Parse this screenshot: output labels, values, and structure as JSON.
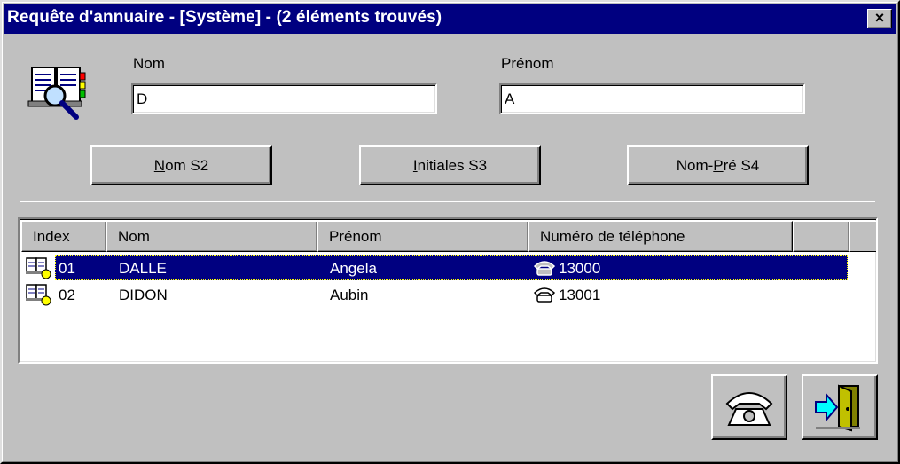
{
  "window": {
    "title": "Requête d'annuaire - [Système] - (2 éléments trouvés)",
    "close_label": "×"
  },
  "search": {
    "nom_label": "Nom",
    "nom_value": "D",
    "prenom_label": "Prénom",
    "prenom_value": "A"
  },
  "buttons": {
    "nom_s2": {
      "mnemonic": "N",
      "rest": "om  S2"
    },
    "initiales_s3": {
      "mnemonic": "I",
      "rest": "nitiales  S3"
    },
    "nompre_s4": {
      "before": "Nom-",
      "mnemonic": "P",
      "rest": "ré  S4"
    }
  },
  "list": {
    "columns": [
      "Index",
      "Nom",
      "Prénom",
      "Numéro de téléphone",
      ""
    ],
    "rows": [
      {
        "index": "01",
        "nom": "DALLE",
        "prenom": "Angela",
        "phone": "13000",
        "selected": true
      },
      {
        "index": "02",
        "nom": "DIDON",
        "prenom": "Aubin",
        "phone": "13001",
        "selected": false
      }
    ]
  },
  "icons": {
    "directory": "directory-search-icon",
    "entry": "contact-book-icon",
    "phone_small": "telephone-icon",
    "call": "telephone-call-icon",
    "exit": "exit-door-icon"
  },
  "colors": {
    "title_bar": "#000080",
    "face": "#c0c0c0",
    "selection": "#000080"
  }
}
